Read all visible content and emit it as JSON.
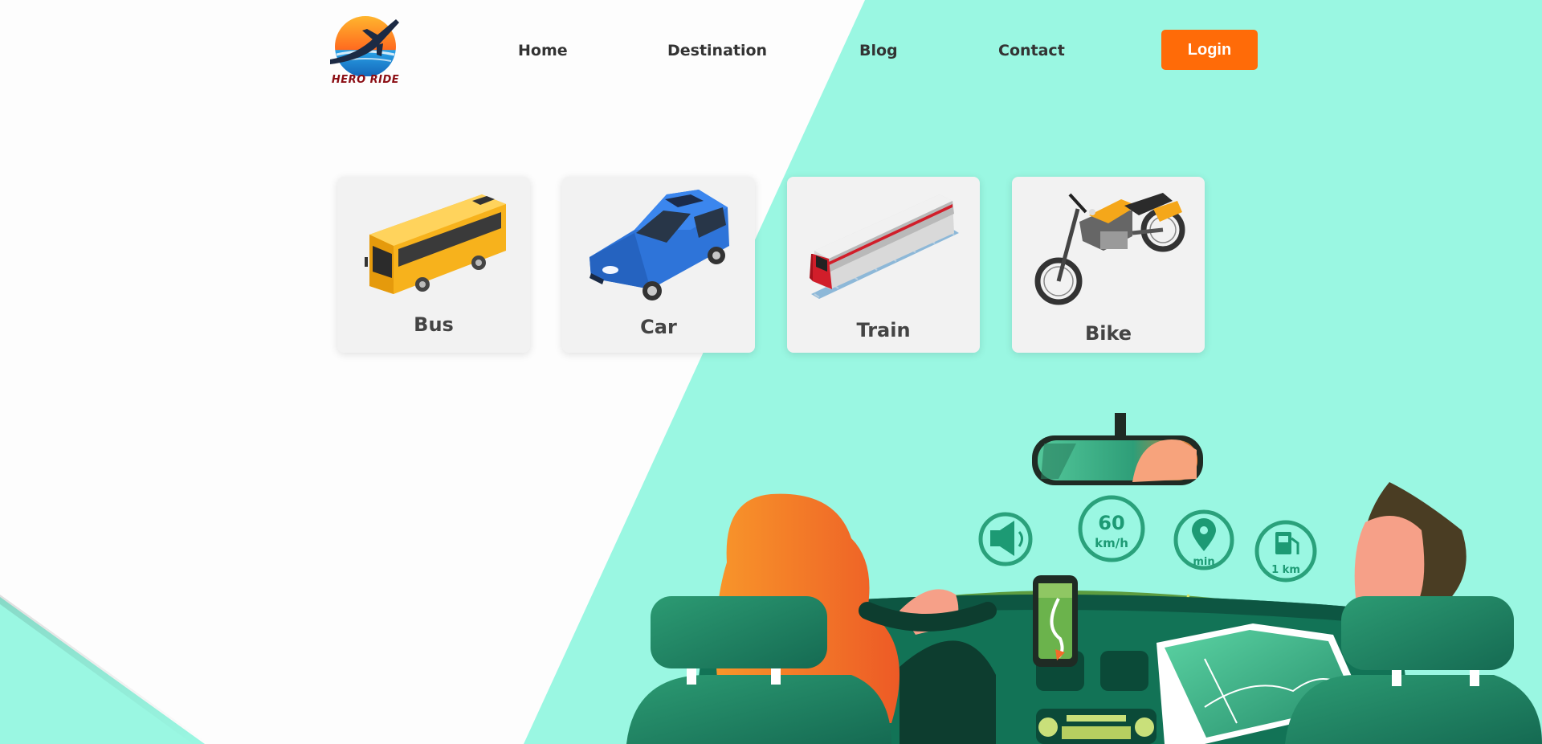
{
  "brand": {
    "logo_text": "HERO RIDE"
  },
  "nav": {
    "items": [
      {
        "label": "Home"
      },
      {
        "label": "Destination"
      },
      {
        "label": "Blog"
      },
      {
        "label": "Contact"
      }
    ],
    "login_label": "Login"
  },
  "vehicles": [
    {
      "label": "Bus",
      "icon": "bus-icon"
    },
    {
      "label": "Car",
      "icon": "car-icon"
    },
    {
      "label": "Train",
      "icon": "train-icon"
    },
    {
      "label": "Bike",
      "icon": "bike-icon"
    }
  ],
  "dashboard": {
    "speed_value": "60",
    "speed_unit": "km/h",
    "eta_label": "min",
    "fuel_label": "1 km",
    "icons": [
      "speaker-icon",
      "location-pin-icon",
      "fuel-pump-icon"
    ]
  },
  "colors": {
    "accent": "#ff6b08",
    "background_mint": "#9af7e2",
    "card": "#f2f2f2",
    "hud_green": "#1d9a74"
  }
}
